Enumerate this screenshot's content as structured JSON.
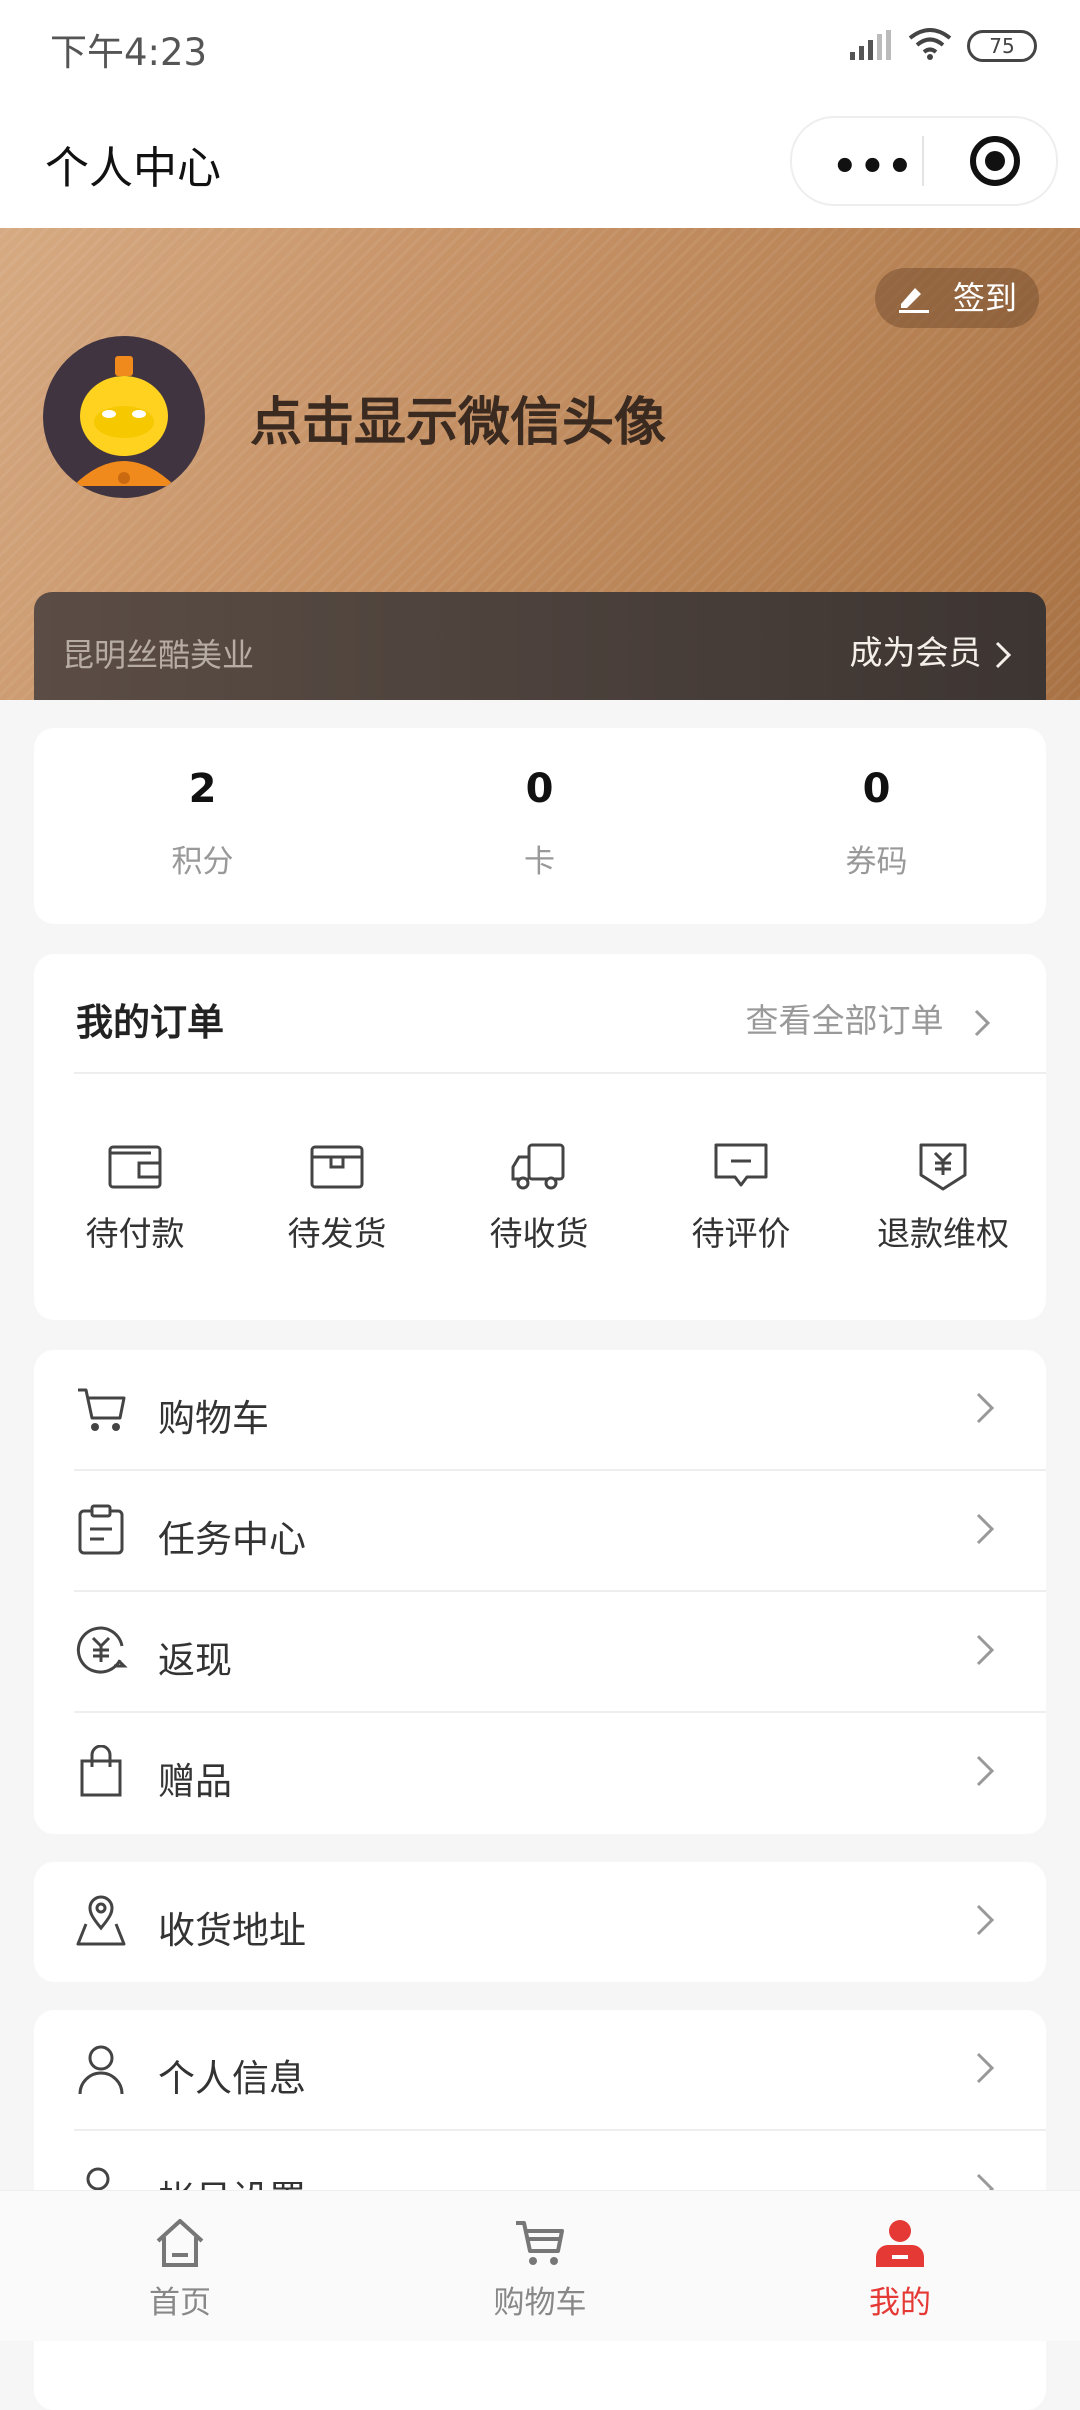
{
  "status_bar": {
    "time": "下午4:23",
    "battery": "75"
  },
  "title_bar": {
    "title": "个人中心"
  },
  "header": {
    "checkin_label": "签到",
    "nickname": "点击显示微信头像",
    "store_name": "昆明丝酷美业",
    "become_member": "成为会员"
  },
  "stats": [
    {
      "value": "2",
      "label": "积分"
    },
    {
      "value": "0",
      "label": "卡"
    },
    {
      "value": "0",
      "label": "券码"
    }
  ],
  "orders": {
    "title": "我的订单",
    "view_all": "查看全部订单",
    "items": [
      {
        "label": "待付款",
        "icon": "wallet-icon"
      },
      {
        "label": "待发货",
        "icon": "box-icon"
      },
      {
        "label": "待收货",
        "icon": "truck-icon"
      },
      {
        "label": "待评价",
        "icon": "comment-icon"
      },
      {
        "label": "退款维权",
        "icon": "refund-icon"
      }
    ]
  },
  "menu_group1": [
    {
      "label": "购物车",
      "icon": "cart-icon"
    },
    {
      "label": "任务中心",
      "icon": "clipboard-icon"
    },
    {
      "label": "返现",
      "icon": "cashback-icon"
    },
    {
      "label": "赠品",
      "icon": "gift-bag-icon"
    }
  ],
  "menu_group2": [
    {
      "label": "收货地址",
      "icon": "map-pin-icon"
    }
  ],
  "menu_group3": [
    {
      "label": "个人信息",
      "icon": "user-icon"
    },
    {
      "label": "帐号设置",
      "icon": "account-settings-icon"
    }
  ],
  "tabbar": [
    {
      "label": "首页",
      "icon": "home-icon"
    },
    {
      "label": "购物车",
      "icon": "cart-icon"
    },
    {
      "label": "我的",
      "icon": "profile-icon",
      "active": true
    }
  ],
  "colors": {
    "accent": "#e53935",
    "banner": "#c9966b"
  }
}
